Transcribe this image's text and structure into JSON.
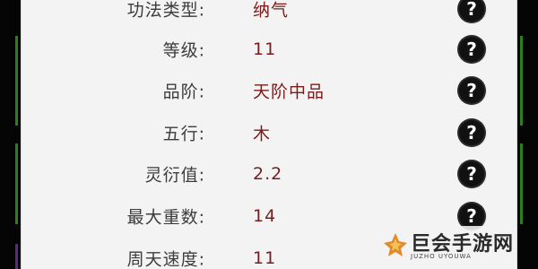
{
  "attributes": [
    {
      "label": "功法类型:",
      "value": "纳气"
    },
    {
      "label": "等级:",
      "value": "11"
    },
    {
      "label": "品阶:",
      "value": "天阶中品"
    },
    {
      "label": "五行:",
      "value": "木"
    },
    {
      "label": "灵衍值:",
      "value": "2.2"
    },
    {
      "label": "最大重数:",
      "value": "14"
    },
    {
      "label": "周天速度:",
      "value": "11"
    }
  ],
  "help_icon": {
    "glyph": "?",
    "icon": "help-icon"
  },
  "watermark": {
    "title": "巨会手游网",
    "subtitle": "JUZHO  UYOUWA"
  },
  "colors": {
    "panel_bg": "#f3f3f3",
    "label_text": "#3c3c3c",
    "value_text": "#7a1b1b",
    "side_green": "#2e7d1f",
    "side_purple": "#5b2a86"
  }
}
